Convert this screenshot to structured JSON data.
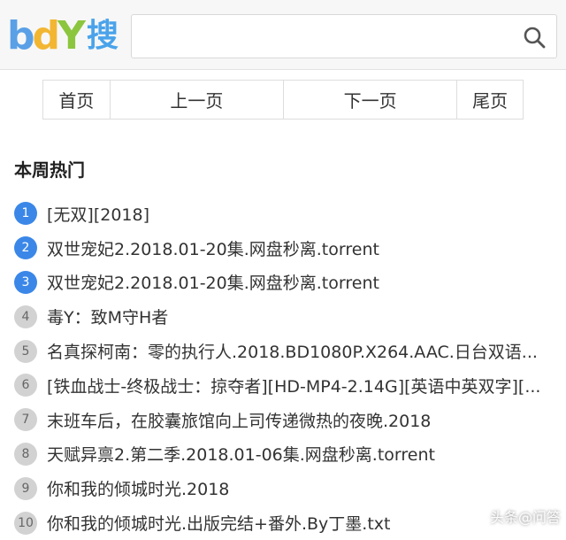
{
  "logo": {
    "latin": [
      "b",
      "d",
      "Y"
    ],
    "cjk": "搜"
  },
  "search": {
    "value": "",
    "placeholder": ""
  },
  "pager": {
    "home": "首页",
    "prev": "上一页",
    "next": "下一页",
    "last": "尾页"
  },
  "section_title": "本周热门",
  "hot_list": [
    {
      "rank": "1",
      "title": "[无双][2018]"
    },
    {
      "rank": "2",
      "title": "双世宠妃2.2018.01-20集.网盘秒离.torrent"
    },
    {
      "rank": "3",
      "title": "双世宠妃2.2018.01-20集.网盘秒离.torrent"
    },
    {
      "rank": "4",
      "title": "毒Y：致M守H者"
    },
    {
      "rank": "5",
      "title": "名真探柯南：零的执行人.2018.BD1080P.X264.AAC.日台双语..."
    },
    {
      "rank": "6",
      "title": "[铁血战士-终极战士：掠夺者][HD-MP4-2.14G][英语中英双字][..."
    },
    {
      "rank": "7",
      "title": "末班车后，在胶囊旅馆向上司传递微热的夜晚.2018"
    },
    {
      "rank": "8",
      "title": "天赋异禀2.第二季.2018.01-06集.网盘秒离.torrent"
    },
    {
      "rank": "9",
      "title": "你和我的倾城时光.2018"
    },
    {
      "rank": "10",
      "title": "你和我的倾城时光.出版完结+番外.By丁墨.txt"
    }
  ],
  "watermark": "头条@问答",
  "colors": {
    "accent": "#3b87e8",
    "rank_normal": "#d2d2d2"
  }
}
